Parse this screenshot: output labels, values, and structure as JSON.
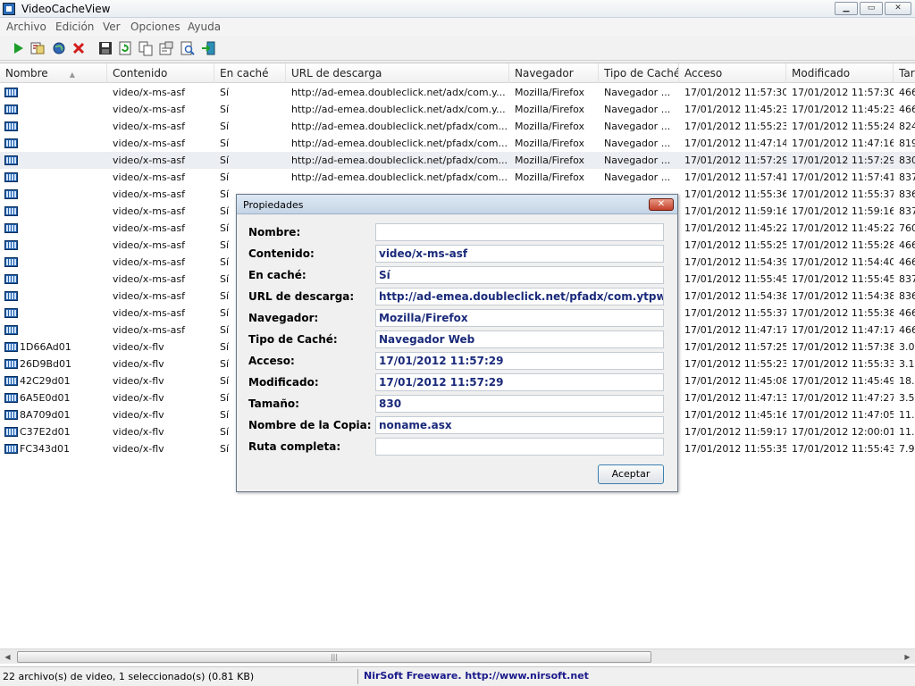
{
  "window": {
    "title": "VideoCacheView",
    "min_symbol": "▁",
    "max_symbol": "▭",
    "close_symbol": "✕"
  },
  "menu": [
    "Archivo",
    "Edición",
    "Ver",
    "Opciones",
    "Ayuda"
  ],
  "toolbar": [
    "play-icon",
    "export-icon",
    "globe-icon",
    "delete-icon",
    "save-icon",
    "refresh-icon",
    "copy-icon",
    "properties-icon",
    "find-icon",
    "exit-icon"
  ],
  "columns": [
    "Nombre",
    "Contenido",
    "En caché",
    "URL de descarga",
    "Navegador",
    "Tipo de Caché",
    "Acceso",
    "Modificado",
    "Tar"
  ],
  "rows": [
    [
      "",
      "video/x-ms-asf",
      "Sí",
      "http://ad-emea.doubleclick.net/adx/com.y...",
      "Mozilla/Firefox",
      "Navegador ...",
      "17/01/2012 11:57:30",
      "17/01/2012 11:57:30",
      "466"
    ],
    [
      "",
      "video/x-ms-asf",
      "Sí",
      "http://ad-emea.doubleclick.net/adx/com.y...",
      "Mozilla/Firefox",
      "Navegador ...",
      "17/01/2012 11:45:23",
      "17/01/2012 11:45:23",
      "466"
    ],
    [
      "",
      "video/x-ms-asf",
      "Sí",
      "http://ad-emea.doubleclick.net/pfadx/com...",
      "Mozilla/Firefox",
      "Navegador ...",
      "17/01/2012 11:55:23",
      "17/01/2012 11:55:24",
      "824"
    ],
    [
      "",
      "video/x-ms-asf",
      "Sí",
      "http://ad-emea.doubleclick.net/pfadx/com...",
      "Mozilla/Firefox",
      "Navegador ...",
      "17/01/2012 11:47:14",
      "17/01/2012 11:47:16",
      "819"
    ],
    [
      "",
      "video/x-ms-asf",
      "Sí",
      "http://ad-emea.doubleclick.net/pfadx/com...",
      "Mozilla/Firefox",
      "Navegador ...",
      "17/01/2012 11:57:29",
      "17/01/2012 11:57:29",
      "830"
    ],
    [
      "",
      "video/x-ms-asf",
      "Sí",
      "http://ad-emea.doubleclick.net/pfadx/com...",
      "Mozilla/Firefox",
      "Navegador ...",
      "17/01/2012 11:57:41",
      "17/01/2012 11:57:41",
      "837"
    ],
    [
      "",
      "video/x-ms-asf",
      "Sí",
      "",
      "",
      "",
      "17/01/2012 11:55:36",
      "17/01/2012 11:55:37",
      "836"
    ],
    [
      "",
      "video/x-ms-asf",
      "Sí",
      "",
      "",
      "",
      "17/01/2012 11:59:16",
      "17/01/2012 11:59:16",
      "837"
    ],
    [
      "",
      "video/x-ms-asf",
      "Sí",
      "",
      "",
      "",
      "17/01/2012 11:45:22",
      "17/01/2012 11:45:22",
      "760"
    ],
    [
      "",
      "video/x-ms-asf",
      "Sí",
      "",
      "",
      "",
      "17/01/2012 11:55:25",
      "17/01/2012 11:55:28",
      "466"
    ],
    [
      "",
      "video/x-ms-asf",
      "Sí",
      "",
      "",
      "",
      "17/01/2012 11:54:39",
      "17/01/2012 11:54:40",
      "466"
    ],
    [
      "",
      "video/x-ms-asf",
      "Sí",
      "",
      "",
      "",
      "17/01/2012 11:55:45",
      "17/01/2012 11:55:45",
      "837"
    ],
    [
      "",
      "video/x-ms-asf",
      "Sí",
      "",
      "",
      "",
      "17/01/2012 11:54:38",
      "17/01/2012 11:54:38",
      "836"
    ],
    [
      "",
      "video/x-ms-asf",
      "Sí",
      "",
      "",
      "",
      "17/01/2012 11:55:37",
      "17/01/2012 11:55:38",
      "466"
    ],
    [
      "",
      "video/x-ms-asf",
      "Sí",
      "",
      "",
      "",
      "17/01/2012 11:47:17",
      "17/01/2012 11:47:17",
      "466"
    ],
    [
      "1D66Ad01",
      "video/x-flv",
      "Sí",
      "",
      "",
      "",
      "17/01/2012 11:57:25",
      "17/01/2012 11:57:38",
      "3.0"
    ],
    [
      "26D9Bd01",
      "video/x-flv",
      "Sí",
      "",
      "",
      "",
      "17/01/2012 11:55:23",
      "17/01/2012 11:55:33",
      "3.1"
    ],
    [
      "42C29d01",
      "video/x-flv",
      "Sí",
      "",
      "",
      "",
      "17/01/2012 11:45:08",
      "17/01/2012 11:45:49",
      "18."
    ],
    [
      "6A5E0d01",
      "video/x-flv",
      "Sí",
      "",
      "",
      "",
      "17/01/2012 11:47:13",
      "17/01/2012 11:47:27",
      "3.5"
    ],
    [
      "8A709d01",
      "video/x-flv",
      "Sí",
      "",
      "",
      "",
      "17/01/2012 11:45:16",
      "17/01/2012 11:47:05",
      "11."
    ],
    [
      "C37E2d01",
      "video/x-flv",
      "Sí",
      "",
      "",
      "",
      "17/01/2012 11:59:17",
      "17/01/2012 12:00:01",
      "11."
    ],
    [
      "FC343d01",
      "video/x-flv",
      "Sí",
      "",
      "",
      "",
      "17/01/2012 11:55:35",
      "17/01/2012 11:55:43",
      "7.9"
    ]
  ],
  "dialog": {
    "title": "Propiedades",
    "close_symbol": "✕",
    "fields": [
      {
        "label": "Nombre:",
        "value": ""
      },
      {
        "label": "Contenido:",
        "value": "video/x-ms-asf"
      },
      {
        "label": "En caché:",
        "value": "Sí"
      },
      {
        "label": "URL de descarga:",
        "value": "http://ad-emea.doubleclick.net/pfadx/com.ytpwmp"
      },
      {
        "label": "Navegador:",
        "value": "Mozilla/Firefox"
      },
      {
        "label": "Tipo de Caché:",
        "value": "Navegador Web"
      },
      {
        "label": "Acceso:",
        "value": "17/01/2012 11:57:29"
      },
      {
        "label": "Modificado:",
        "value": "17/01/2012 11:57:29"
      },
      {
        "label": "Tamaño:",
        "value": "830"
      },
      {
        "label": "Nombre de la Copia:",
        "value": "noname.asx"
      },
      {
        "label": "Ruta completa:",
        "value": ""
      }
    ],
    "ok_label": "Aceptar"
  },
  "statusbar": {
    "count": "22 archivo(s) de video, 1 seleccionado(s)  (0.81 KB)",
    "credit": "NirSoft Freeware.  http://www.nirsoft.net"
  },
  "scrollbar": {
    "left_arrow": "◀",
    "right_arrow": "▶",
    "grip": "|||"
  },
  "colors": {
    "selected_row": "#ebeef2",
    "dialog_text": "#1a2a7a",
    "credit_text": "#1a1a8c",
    "close_red": "#c3402a"
  }
}
